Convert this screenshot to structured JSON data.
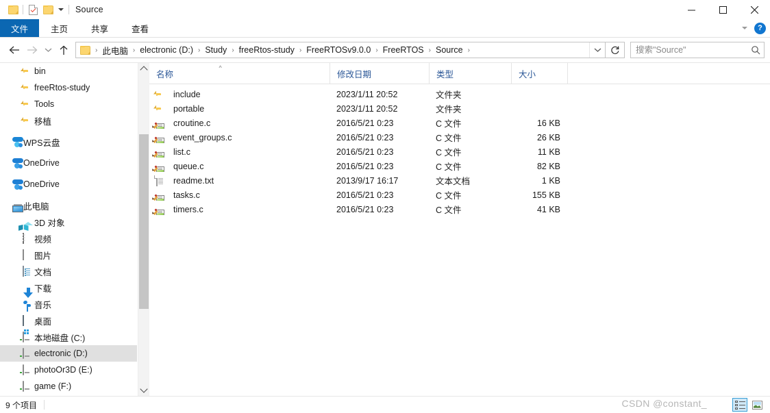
{
  "window": {
    "title": "Source",
    "quick_access": [
      {
        "name": "folder-icon",
        "label": ""
      },
      {
        "name": "properties-checked-doc-icon",
        "label": ""
      },
      {
        "name": "new-folder-icon",
        "label": ""
      }
    ],
    "controls": {
      "minimize": "minimize-button",
      "maximize": "maximize-button",
      "close": "close-button"
    }
  },
  "ribbon": {
    "tabs": [
      {
        "label": "文件",
        "active": true
      },
      {
        "label": "主页",
        "active": false
      },
      {
        "label": "共享",
        "active": false
      },
      {
        "label": "查看",
        "active": false
      }
    ],
    "help_label": "?"
  },
  "address": {
    "back": "←",
    "forward": "→",
    "recent": "⌄",
    "up": "↑",
    "crumbs": [
      "此电脑",
      "electronic (D:)",
      "Study",
      "freeRtos-study",
      "FreeRTOSv9.0.0",
      "FreeRTOS",
      "Source"
    ],
    "separator": "›",
    "refresh_title": "刷新"
  },
  "search": {
    "placeholder": "搜索\"Source\"",
    "value": ""
  },
  "sidebar": {
    "items": [
      {
        "label": "bin",
        "icon": "folder-icon",
        "indent": 1,
        "selected": false
      },
      {
        "label": "freeRtos-study",
        "icon": "folder-icon",
        "indent": 1,
        "selected": false
      },
      {
        "label": "Tools",
        "icon": "folder-icon",
        "indent": 1,
        "selected": false
      },
      {
        "label": "移植",
        "icon": "folder-icon",
        "indent": 1,
        "selected": false
      },
      {
        "label": "WPS云盘",
        "icon": "wps-cloud-icon",
        "indent": 0,
        "selected": false,
        "gap_before": true
      },
      {
        "label": "OneDrive",
        "icon": "onedrive-cloud-icon",
        "indent": 0,
        "selected": false,
        "gap_before": true
      },
      {
        "label": "OneDrive",
        "icon": "onedrive-cloud-icon",
        "indent": 0,
        "selected": false,
        "gap_before": true
      },
      {
        "label": "此电脑",
        "icon": "this-pc-icon",
        "indent": 0,
        "selected": false,
        "gap_before": true
      },
      {
        "label": "3D 对象",
        "icon": "3d-objects-icon",
        "indent": 1,
        "selected": false
      },
      {
        "label": "视频",
        "icon": "videos-icon",
        "indent": 1,
        "selected": false
      },
      {
        "label": "图片",
        "icon": "pictures-icon",
        "indent": 1,
        "selected": false
      },
      {
        "label": "文档",
        "icon": "documents-icon",
        "indent": 1,
        "selected": false
      },
      {
        "label": "下载",
        "icon": "downloads-icon",
        "indent": 1,
        "selected": false
      },
      {
        "label": "音乐",
        "icon": "music-icon",
        "indent": 1,
        "selected": false
      },
      {
        "label": "桌面",
        "icon": "desktop-icon",
        "indent": 1,
        "selected": false
      },
      {
        "label": "本地磁盘 (C:)",
        "icon": "system-drive-icon",
        "indent": 1,
        "selected": false
      },
      {
        "label": "electronic (D:)",
        "icon": "drive-icon",
        "indent": 1,
        "selected": true
      },
      {
        "label": "photoOr3D (E:)",
        "icon": "drive-icon",
        "indent": 1,
        "selected": false
      },
      {
        "label": "game (F:)",
        "icon": "drive-icon",
        "indent": 1,
        "selected": false
      }
    ]
  },
  "file_list": {
    "columns": [
      {
        "label": "名称",
        "sorted": true,
        "sort_glyph": "^"
      },
      {
        "label": "修改日期",
        "sorted": false,
        "sort_glyph": ""
      },
      {
        "label": "类型",
        "sorted": false,
        "sort_glyph": ""
      },
      {
        "label": "大小",
        "sorted": false,
        "sort_glyph": ""
      }
    ],
    "rows": [
      {
        "name": "include",
        "icon": "folder-icon",
        "date": "2023/1/11 20:52",
        "type": "文件夹",
        "size": ""
      },
      {
        "name": "portable",
        "icon": "folder-icon",
        "date": "2023/1/11 20:52",
        "type": "文件夹",
        "size": ""
      },
      {
        "name": "croutine.c",
        "icon": "c-file-icon",
        "date": "2016/5/21 0:23",
        "type": "C 文件",
        "size": "16 KB"
      },
      {
        "name": "event_groups.c",
        "icon": "c-file-icon",
        "date": "2016/5/21 0:23",
        "type": "C 文件",
        "size": "26 KB"
      },
      {
        "name": "list.c",
        "icon": "c-file-icon",
        "date": "2016/5/21 0:23",
        "type": "C 文件",
        "size": "11 KB"
      },
      {
        "name": "queue.c",
        "icon": "c-file-icon",
        "date": "2016/5/21 0:23",
        "type": "C 文件",
        "size": "82 KB"
      },
      {
        "name": "readme.txt",
        "icon": "text-file-icon",
        "date": "2013/9/17 16:17",
        "type": "文本文档",
        "size": "1 KB"
      },
      {
        "name": "tasks.c",
        "icon": "c-file-icon",
        "date": "2016/5/21 0:23",
        "type": "C 文件",
        "size": "155 KB"
      },
      {
        "name": "timers.c",
        "icon": "c-file-icon",
        "date": "2016/5/21 0:23",
        "type": "C 文件",
        "size": "41 KB"
      }
    ]
  },
  "status": {
    "item_count": "9 个项目",
    "view_details": "详细信息视图",
    "view_large_icons": "大图标视图"
  },
  "watermark": {
    "text": "CSDN @constant_"
  },
  "colors": {
    "accent": "#0b67b2",
    "column_header": "#2b5797",
    "selection": "#e0e0e0",
    "folder": "#fcd469"
  }
}
